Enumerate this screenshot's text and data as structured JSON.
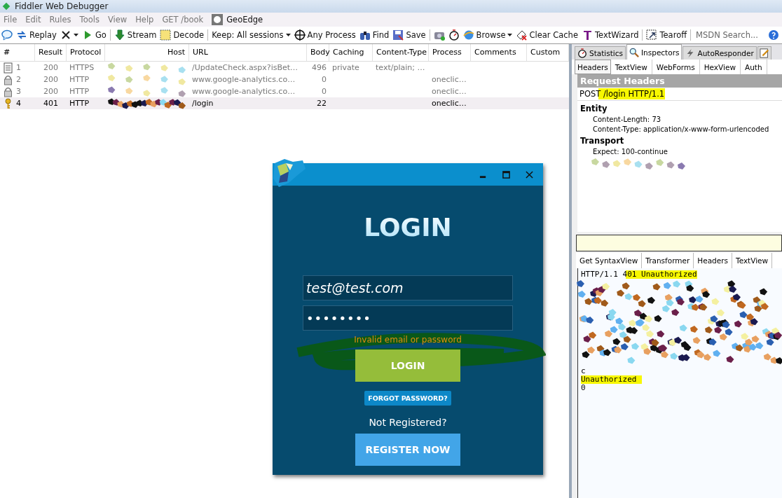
{
  "window": {
    "title": "Fiddler Web Debugger"
  },
  "menu": [
    {
      "label": "File"
    },
    {
      "label": "Edit"
    },
    {
      "label": "Rules"
    },
    {
      "label": "Tools"
    },
    {
      "label": "View"
    },
    {
      "label": "Help"
    },
    {
      "label": "GET /book"
    },
    {
      "label": "GeoEdge",
      "kind": "icon"
    }
  ],
  "toolbar": [
    {
      "kind": "icon"
    },
    {
      "kind": "button",
      "label": "Replay"
    },
    {
      "kind": "dropdown"
    },
    {
      "kind": "button",
      "label": "Go"
    },
    {
      "kind": "separator"
    },
    {
      "kind": "button",
      "label": "Stream"
    },
    {
      "kind": "button",
      "label": "Decode"
    },
    {
      "kind": "separator"
    },
    {
      "kind": "dropdown",
      "label": "Keep: All sessions"
    },
    {
      "kind": "button",
      "label": "Any Process"
    },
    {
      "kind": "button",
      "label": "Find"
    },
    {
      "kind": "button",
      "label": "Save"
    },
    {
      "kind": "separator"
    },
    {
      "kind": "icon"
    },
    {
      "kind": "icon"
    },
    {
      "kind": "dropdown",
      "label": "Browse"
    },
    {
      "kind": "button",
      "label": "Clear Cache"
    },
    {
      "kind": "button",
      "label": "TextWizard"
    },
    {
      "kind": "separator"
    },
    {
      "kind": "button",
      "label": "Tearoff"
    },
    {
      "kind": "separator"
    },
    {
      "kind": "field",
      "placeholder": "MSDN Search..."
    },
    {
      "kind": "icon"
    }
  ],
  "sessions": {
    "columns": [
      "#",
      "Result",
      "Protocol",
      "Host",
      "URL",
      "Body",
      "Caching",
      "Content-Type",
      "Process",
      "Comments",
      "Custom"
    ],
    "rows": [
      {
        "num": "1",
        "kind": "document",
        "result": "200",
        "protocol": "HTTPS",
        "url": "/UpdateCheck.aspx?isBet…",
        "body": "496",
        "caching": "private",
        "content_type": "text/plain; …",
        "selected": false
      },
      {
        "num": "2",
        "kind": "lock",
        "result": "200",
        "protocol": "HTTP",
        "url": "www.google-analytics.co…",
        "body": "0",
        "process": "oneclic…",
        "selected": false
      },
      {
        "num": "3",
        "kind": "lock",
        "result": "200",
        "protocol": "HTTP",
        "url": "www.google-analytics.co…",
        "body": "0",
        "process": "oneclic…",
        "selected": false
      },
      {
        "num": "4",
        "kind": "key",
        "result": "401",
        "protocol": "HTTP",
        "url": "/login",
        "body": "22",
        "process": "oneclic…",
        "selected": true
      }
    ]
  },
  "inspector": {
    "tabs": [
      {
        "label": "Statistics",
        "selected": false
      },
      {
        "label": "Inspectors",
        "selected": true
      },
      {
        "label": "AutoResponder",
        "selected": false
      },
      {
        "kind": "icon",
        "selected": false
      }
    ],
    "request_tabs": [
      {
        "label": "Headers",
        "selected": true
      },
      {
        "label": "TextView",
        "selected": false
      },
      {
        "label": "WebForms",
        "selected": false
      },
      {
        "label": "HexView",
        "selected": false
      },
      {
        "label": "Auth",
        "selected": false
      }
    ],
    "request_title": "Request Headers",
    "request_line": {
      "text": "POST /login HTTP/1.1",
      "highlighted": true
    },
    "groups": [
      {
        "name": "Entity",
        "headers": [
          "Content-Length: 73",
          "Content-Type: application/x-www-form-urlencoded"
        ]
      },
      {
        "name": "Transport",
        "headers": [
          "Expect: 100-continue"
        ]
      }
    ],
    "response_tabs": [
      {
        "label": "Get SyntaxView",
        "selected": false
      },
      {
        "label": "Transformer",
        "selected": false
      },
      {
        "label": "Headers",
        "selected": false
      },
      {
        "label": "TextView",
        "selected": false
      }
    ],
    "response_status": {
      "text": "HTTP/1.1 401 Unauthorized",
      "highlighted": true
    },
    "response_body": [
      {
        "text": "c",
        "highlighted": false
      },
      {
        "text": "Unauthorized",
        "highlighted": true
      },
      {
        "text": "0",
        "highlighted": false
      }
    ]
  },
  "login": {
    "heading": "LOGIN",
    "email": "test@test.com",
    "password": "••••••••",
    "error": "Invalid email or password",
    "login_button": "LOGIN",
    "forgot_button": "FORGOT PASSWORD?",
    "prompt": "Not Registered?",
    "register_button": "REGISTER NOW"
  }
}
